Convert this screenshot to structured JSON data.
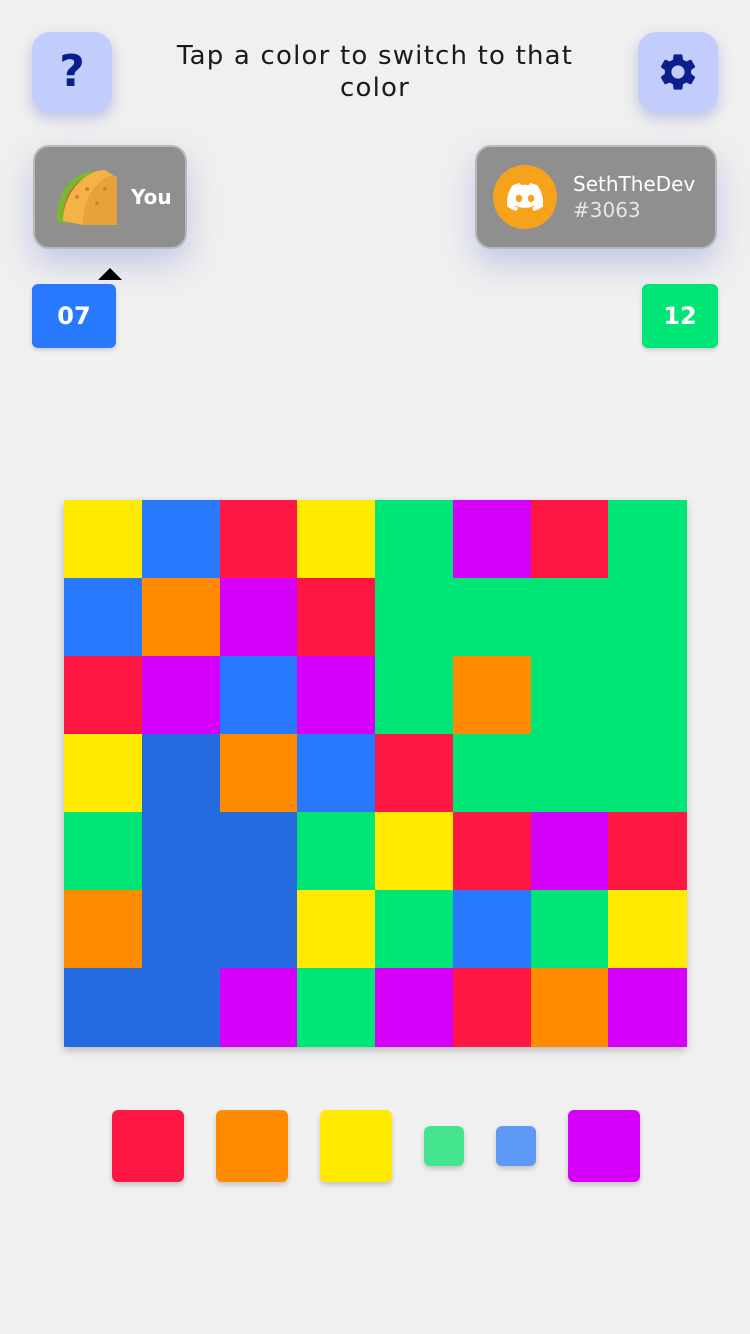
{
  "header": {
    "instruction": "Tap a color to switch to that color",
    "help_icon": "question-mark-icon",
    "help_label": "?",
    "settings_icon": "gear-icon"
  },
  "players": {
    "you": {
      "name": "You",
      "avatar_icon": "taco-icon",
      "score": "07",
      "score_color": "#2979ff",
      "has_turn": true
    },
    "opponent": {
      "name": "SethTheDev",
      "tag": "#3063",
      "avatar_icon": "discord-icon",
      "avatar_color": "#f7a21b",
      "score": "12",
      "score_color": "#00e676"
    }
  },
  "colors": {
    "R": "#ff1744",
    "O": "#ff8c00",
    "Y": "#ffea00",
    "G": "#00e676",
    "B": "#2979ff",
    "D": "#256bdf",
    "P": "#d500f9"
  },
  "board": {
    "rows": 7,
    "cols": 8,
    "grid": [
      "YBRYGPRG",
      "BOPRGGGG",
      "RPBPGOGG",
      "YDOBRGGG",
      "GDDGYRPR",
      "ODDYGBGY",
      "DDPGPROP"
    ]
  },
  "palette": [
    {
      "name": "red",
      "color": "#ff1744",
      "available": true
    },
    {
      "name": "orange",
      "color": "#ff8c00",
      "available": true
    },
    {
      "name": "yellow",
      "color": "#ffea00",
      "available": true
    },
    {
      "name": "green",
      "color": "#45e590",
      "available": false
    },
    {
      "name": "blue",
      "color": "#5d99f5",
      "available": false
    },
    {
      "name": "purple",
      "color": "#d500f9",
      "available": true
    }
  ]
}
